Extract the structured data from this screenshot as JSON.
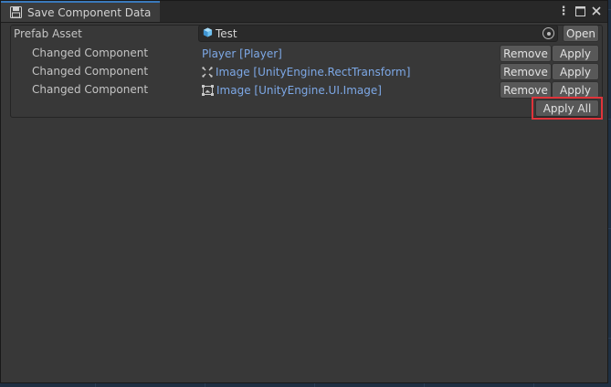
{
  "window": {
    "tab_title": "Save Component Data",
    "icons": {
      "tab": "save-floppy-icon",
      "menu": "kebab-menu-icon",
      "maximize": "maximize-icon",
      "close": "close-icon"
    }
  },
  "prefab": {
    "label": "Prefab Asset",
    "value": "Test",
    "value_icon": "prefab-cube-icon",
    "open_label": "Open"
  },
  "components": [
    {
      "label": "Changed Component",
      "name": "Player [Player]",
      "icon": "",
      "remove_label": "Remove",
      "apply_label": "Apply"
    },
    {
      "label": "Changed Component",
      "name": "Image [UnityEngine.RectTransform]",
      "icon": "rect-transform-icon",
      "remove_label": "Remove",
      "apply_label": "Apply"
    },
    {
      "label": "Changed Component",
      "name": "Image [UnityEngine.UI.Image]",
      "icon": "image-component-icon",
      "remove_label": "Remove",
      "apply_label": "Apply"
    }
  ],
  "footer": {
    "apply_all_label": "Apply All"
  },
  "colors": {
    "link": "#7da8e6",
    "highlight": "#e0343b",
    "tab_accent": "#3a79bb",
    "window_bg": "#383838"
  }
}
